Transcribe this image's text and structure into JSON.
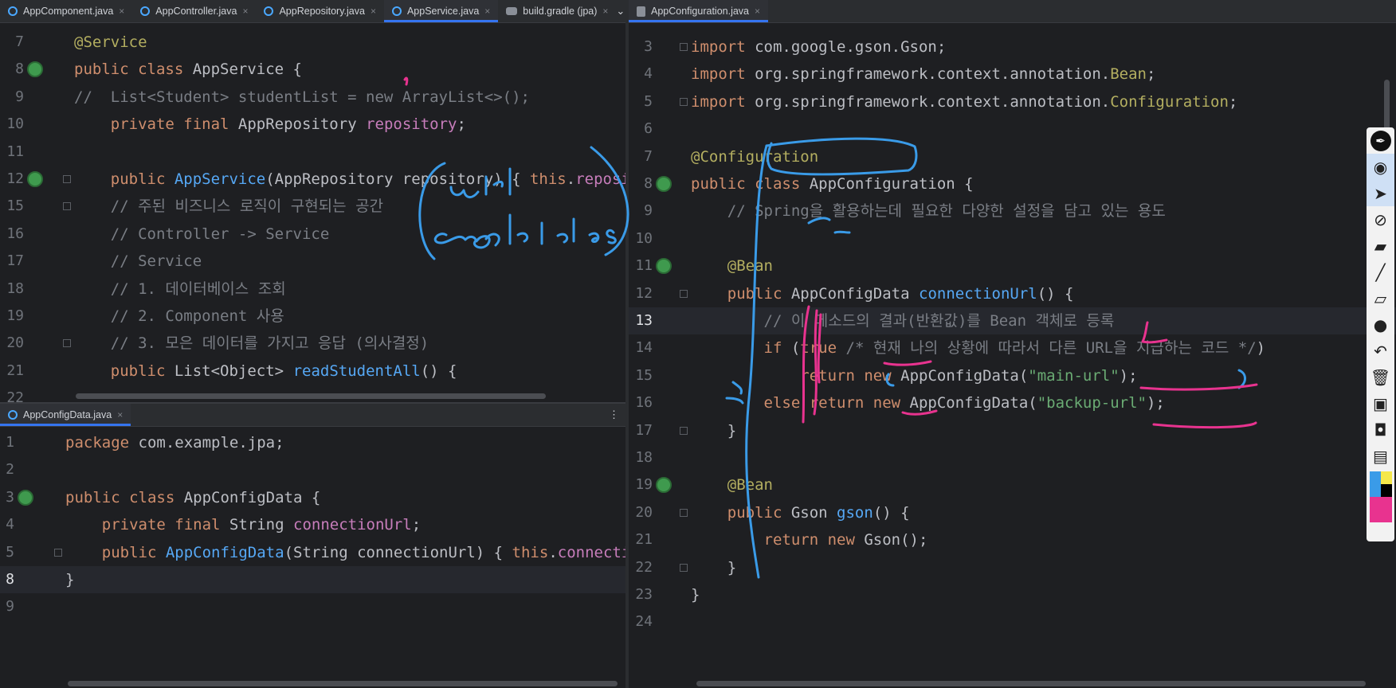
{
  "left_top": {
    "tabs": [
      {
        "label": "AppComponent.java",
        "icon": "java-class-icon"
      },
      {
        "label": "AppController.java",
        "icon": "java-class-icon"
      },
      {
        "label": "AppRepository.java",
        "icon": "java-class-icon"
      },
      {
        "label": "AppService.java",
        "icon": "java-class-icon",
        "active": true
      },
      {
        "label": "build.gradle (jpa)",
        "icon": "gradle-icon"
      }
    ],
    "warnings": "⚠1",
    "lines": [
      {
        "n": "7",
        "code": [
          [
            "an",
            "@Service"
          ]
        ]
      },
      {
        "n": "8",
        "code": [
          [
            "k",
            "public class "
          ],
          [
            "t",
            "AppService {"
          ]
        ]
      },
      {
        "n": "9",
        "code": [
          [
            "c",
            "//  List<Student> studentList = new ArrayList<>();"
          ]
        ]
      },
      {
        "n": "10",
        "code": [
          [
            "t",
            "    "
          ],
          [
            "k",
            "private final "
          ],
          [
            "t",
            "AppRepository "
          ],
          [
            "fld",
            "repository"
          ],
          [
            "t",
            ";"
          ]
        ]
      },
      {
        "n": "11",
        "code": []
      },
      {
        "n": "12",
        "code": [
          [
            "t",
            "    "
          ],
          [
            "k",
            "public "
          ],
          [
            "f",
            "AppService"
          ],
          [
            "t",
            "(AppRepository repository) { "
          ],
          [
            "k",
            "this"
          ],
          [
            "t",
            "."
          ],
          [
            "fld",
            "repositor"
          ]
        ]
      },
      {
        "n": "15",
        "code": [
          [
            "c",
            "    // 주된 비즈니스 로직이 구현되는 공간"
          ]
        ]
      },
      {
        "n": "16",
        "code": [
          [
            "c",
            "    // Controller -> Service"
          ]
        ]
      },
      {
        "n": "17",
        "code": [
          [
            "c",
            "    // Service"
          ]
        ]
      },
      {
        "n": "18",
        "code": [
          [
            "c",
            "    // 1. 데이터베이스 조회"
          ]
        ]
      },
      {
        "n": "19",
        "code": [
          [
            "c",
            "    // 2. Component 사용"
          ]
        ]
      },
      {
        "n": "20",
        "code": [
          [
            "c",
            "    // 3. 모은 데이터를 가지고 응답 (의사결정)"
          ]
        ]
      },
      {
        "n": "21",
        "code": [
          [
            "t",
            "    "
          ],
          [
            "k",
            "public "
          ],
          [
            "t",
            "List<Object> "
          ],
          [
            "f",
            "readStudentAll"
          ],
          [
            "t",
            "() {"
          ]
        ]
      },
      {
        "n": "22",
        "code": []
      }
    ],
    "annotation_text": "url credentials"
  },
  "left_bottom": {
    "tabs": [
      {
        "label": "AppConfigData.java",
        "icon": "java-class-icon",
        "active": true
      }
    ],
    "warnings": "⚠2",
    "lines": [
      {
        "n": "1",
        "code": [
          [
            "k",
            "package "
          ],
          [
            "t",
            "com.example.jpa;"
          ]
        ]
      },
      {
        "n": "2",
        "code": []
      },
      {
        "n": "3",
        "code": [
          [
            "k",
            "public class "
          ],
          [
            "t",
            "AppConfigData {"
          ]
        ]
      },
      {
        "n": "4",
        "code": [
          [
            "t",
            "    "
          ],
          [
            "k",
            "private final "
          ],
          [
            "t",
            "String "
          ],
          [
            "fld",
            "connectionUrl"
          ],
          [
            "t",
            ";"
          ]
        ]
      },
      {
        "n": "5",
        "code": [
          [
            "t",
            "    "
          ],
          [
            "k",
            "public "
          ],
          [
            "f",
            "AppConfigData"
          ],
          [
            "t",
            "(String connectionUrl) { "
          ],
          [
            "k",
            "this"
          ],
          [
            "t",
            "."
          ],
          [
            "fld",
            "connectionU"
          ]
        ]
      },
      {
        "n": "8",
        "code": [
          [
            "t",
            "}"
          ]
        ]
      },
      {
        "n": "9",
        "code": []
      }
    ]
  },
  "right": {
    "tabs": [
      {
        "label": "AppConfiguration.java",
        "icon": "java-file-icon",
        "active": true
      }
    ],
    "warnings": "⚠1 ✓2",
    "lines": [
      {
        "n": "3",
        "code": [
          [
            "k",
            "import "
          ],
          [
            "t",
            "com.google.gson.Gson;"
          ]
        ]
      },
      {
        "n": "4",
        "code": [
          [
            "k",
            "import "
          ],
          [
            "t",
            "org.springframework.context.annotation."
          ],
          [
            "an",
            "Bean"
          ],
          [
            "t",
            ";"
          ]
        ]
      },
      {
        "n": "5",
        "code": [
          [
            "k",
            "import "
          ],
          [
            "t",
            "org.springframework.context.annotation."
          ],
          [
            "an",
            "Configuration"
          ],
          [
            "t",
            ";"
          ]
        ]
      },
      {
        "n": "6",
        "code": []
      },
      {
        "n": "7",
        "code": [
          [
            "an",
            "@Configuration"
          ]
        ]
      },
      {
        "n": "8",
        "code": [
          [
            "k",
            "public class "
          ],
          [
            "t",
            "AppConfiguration {"
          ]
        ]
      },
      {
        "n": "9",
        "code": [
          [
            "c",
            "    // Spring을 활용하는데 필요한 다양한 설정을 담고 있는 용도"
          ]
        ]
      },
      {
        "n": "10",
        "code": []
      },
      {
        "n": "11",
        "code": [
          [
            "an",
            "    @Bean"
          ]
        ]
      },
      {
        "n": "12",
        "code": [
          [
            "t",
            "    "
          ],
          [
            "k",
            "public "
          ],
          [
            "t",
            "AppConfigData "
          ],
          [
            "f",
            "connectionUrl"
          ],
          [
            "t",
            "() {"
          ]
        ]
      },
      {
        "n": "13",
        "code": [
          [
            "c",
            "        // 이 메소드의 결과(반환값)를 Bean 객체로 등록"
          ]
        ]
      },
      {
        "n": "14",
        "code": [
          [
            "t",
            "        "
          ],
          [
            "k",
            "if "
          ],
          [
            "t",
            "("
          ],
          [
            "k",
            "true"
          ],
          [
            "t",
            " "
          ],
          [
            "c",
            "/* 현재 나의 상황에 따라서 다른 URL을 지급하는 코드 */"
          ],
          [
            "t",
            ")"
          ]
        ]
      },
      {
        "n": "15",
        "code": [
          [
            "t",
            "            "
          ],
          [
            "k",
            "return new "
          ],
          [
            "t",
            "AppConfigData("
          ],
          [
            "s",
            "\"main-url\""
          ],
          [
            "t",
            ");"
          ]
        ]
      },
      {
        "n": "16",
        "code": [
          [
            "t",
            "        "
          ],
          [
            "k",
            "else return new "
          ],
          [
            "t",
            "AppConfigData("
          ],
          [
            "s",
            "\"backup-url\""
          ],
          [
            "t",
            ");"
          ]
        ]
      },
      {
        "n": "17",
        "code": [
          [
            "t",
            "    }"
          ]
        ]
      },
      {
        "n": "18",
        "code": []
      },
      {
        "n": "19",
        "code": [
          [
            "an",
            "    @Bean"
          ]
        ]
      },
      {
        "n": "20",
        "code": [
          [
            "t",
            "    "
          ],
          [
            "k",
            "public "
          ],
          [
            "t",
            "Gson "
          ],
          [
            "f",
            "gson"
          ],
          [
            "t",
            "() {"
          ]
        ]
      },
      {
        "n": "21",
        "code": [
          [
            "t",
            "        "
          ],
          [
            "k",
            "return new "
          ],
          [
            "t",
            "Gson();"
          ]
        ]
      },
      {
        "n": "22",
        "code": [
          [
            "t",
            "    }"
          ]
        ]
      },
      {
        "n": "23",
        "code": [
          [
            "t",
            "}"
          ]
        ]
      },
      {
        "n": "24",
        "code": []
      }
    ]
  },
  "toolbar": {
    "tools": [
      "pen-icon",
      "eye-icon",
      "cursor-icon",
      "no-pen-icon",
      "highlighter-icon",
      "line-icon",
      "eraser-icon",
      "dot-icon",
      "undo-icon",
      "trash-icon",
      "screen-icon",
      "camera-icon",
      "clipboard-icon",
      "color-palette-icon"
    ]
  },
  "colors": {
    "annotation_blue": "#3a9be8",
    "annotation_pink": "#e8338f"
  }
}
